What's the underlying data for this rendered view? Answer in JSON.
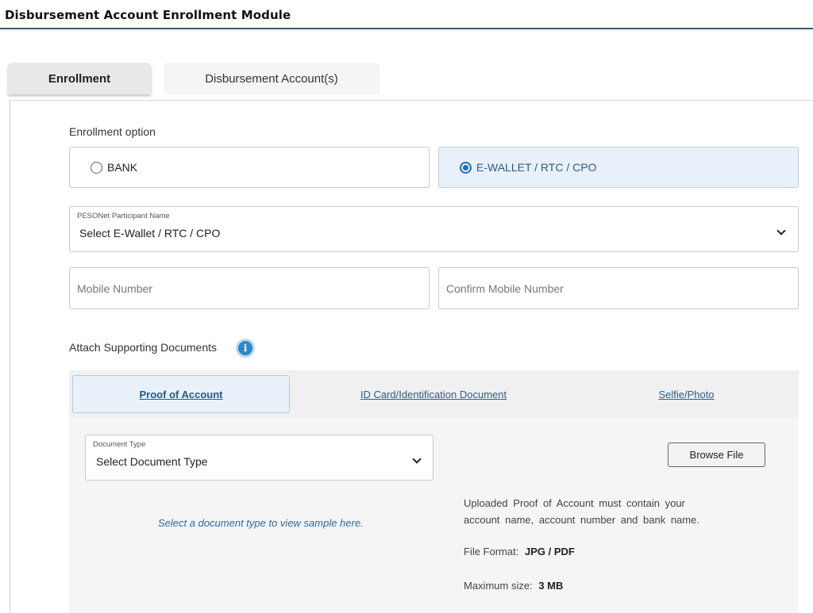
{
  "header": {
    "title": "Disbursement Account Enrollment Module"
  },
  "tabs": [
    {
      "label": "Enrollment",
      "active": true
    },
    {
      "label": "Disbursement Account(s)",
      "active": false
    }
  ],
  "enrollment": {
    "option_label": "Enrollment option",
    "options": [
      {
        "label": "BANK",
        "selected": false
      },
      {
        "label": "E-WALLET / RTC / CPO",
        "selected": true
      }
    ],
    "participant": {
      "float_label": "PESONet Participant Name",
      "value": "Select E-Wallet / RTC / CPO",
      "icon": "chevron-down-icon"
    },
    "mobile": {
      "placeholder": "Mobile Number",
      "value": ""
    },
    "confirm_mobile": {
      "placeholder": "Confirm Mobile Number",
      "value": ""
    }
  },
  "documents": {
    "label": "Attach Supporting Documents",
    "info_icon": "info-icon",
    "tabs": [
      {
        "label": "Proof of Account",
        "active": true
      },
      {
        "label": "ID Card/Identification Document",
        "active": false
      },
      {
        "label": "Selfie/Photo",
        "active": false
      }
    ],
    "document_type": {
      "float_label": "Document Type",
      "value": "Select Document Type",
      "icon": "chevron-down-icon"
    },
    "browse_label": "Browse File",
    "sample_hint": "Select a document type to view sample here.",
    "requirement_line1": "Uploaded Proof of Account must contain your",
    "requirement_line2": "account name, account number and bank name.",
    "file_format_label": "File Format:",
    "file_format_value": "JPG / PDF",
    "max_size_label": "Maximum size:",
    "max_size_value": "3 MB"
  },
  "colors": {
    "accent": "#1f6fb5",
    "link": "#2b5d86",
    "selected_bg": "#e8f1fa",
    "header_rule": "#3d5a6e"
  }
}
